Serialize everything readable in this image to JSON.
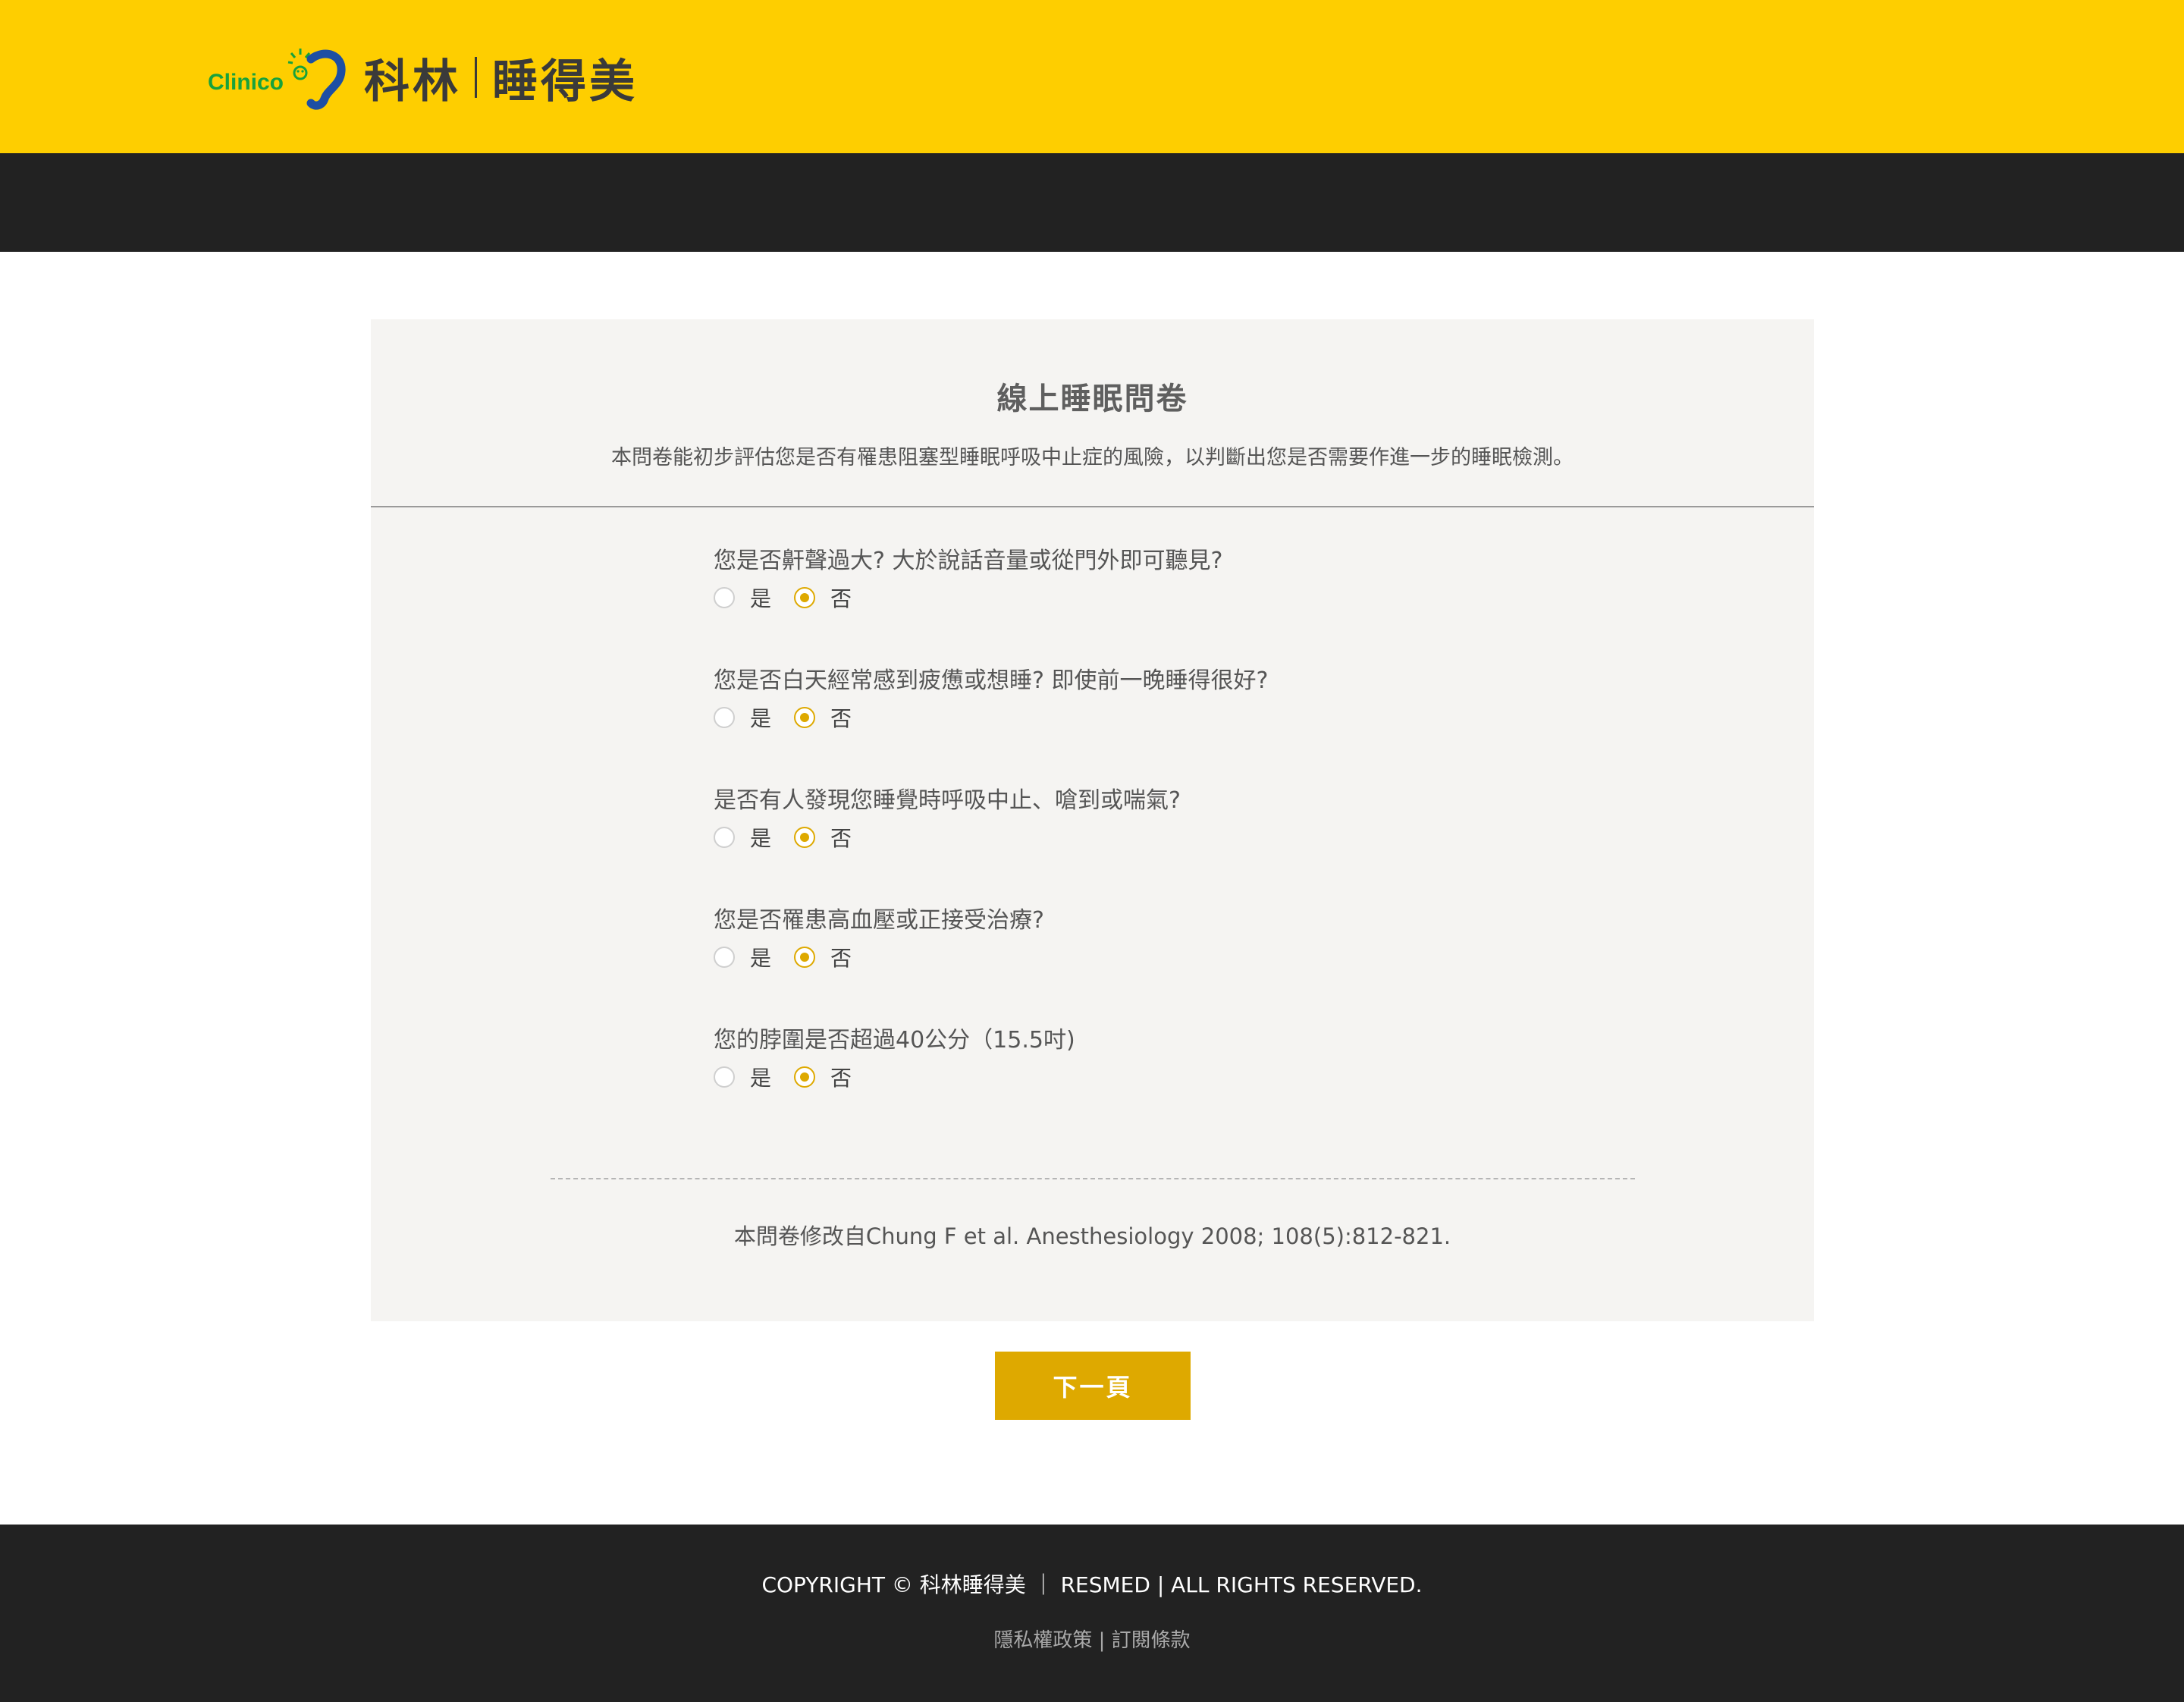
{
  "header": {
    "logo_word": "Clinico",
    "brand_left": "科林",
    "brand_right": "睡得美"
  },
  "survey": {
    "title": "線上睡眠問卷",
    "intro": "本問卷能初步評估您是否有罹患阻塞型睡眠呼吸中止症的風險，以判斷出您是否需要作進一步的睡眠檢測。",
    "options": {
      "yes": "是",
      "no": "否"
    },
    "questions": [
      {
        "text": "您是否鼾聲過大? 大於說話音量或從門外即可聽見?",
        "selected": "否"
      },
      {
        "text": "您是否白天經常感到疲憊或想睡? 即使前一晚睡得很好?",
        "selected": "否"
      },
      {
        "text": "是否有人發現您睡覺時呼吸中止、嗆到或喘氣?",
        "selected": "否"
      },
      {
        "text": "您是否罹患高血壓或正接受治療?",
        "selected": "否"
      },
      {
        "text": "您的脖圍是否超過40公分（15.5吋)",
        "selected": "否"
      }
    ],
    "source": "本問卷修改自Chung F et al. Anesthesiology 2008; 108(5):812-821."
  },
  "next_button": "下一頁",
  "footer": {
    "copyright": "COPYRIGHT © 科林睡得美 ｜ RESMED | ALL RIGHTS RESERVED.",
    "privacy": "隱私權政策",
    "separator": "|",
    "terms": "訂閱條款"
  },
  "colors": {
    "header_yellow": "#FECE00",
    "dark_bar": "#222222",
    "accent": "#DEA900",
    "card_bg": "#F5F4F2",
    "logo_green": "#17A23C",
    "logo_blue": "#1D4FA3"
  }
}
